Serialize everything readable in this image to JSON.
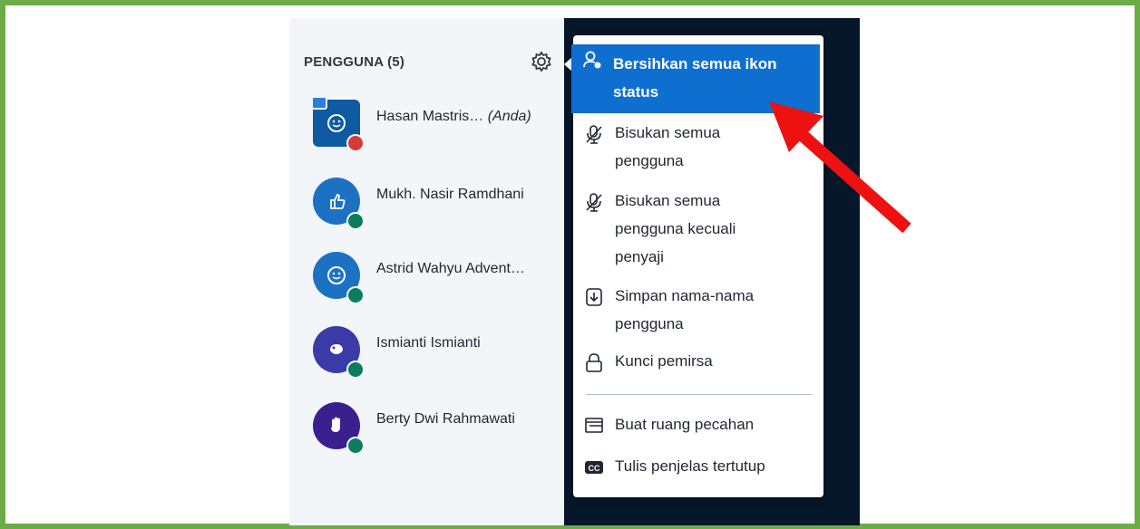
{
  "panel": {
    "title": "PENGGUNA (5)",
    "users": [
      {
        "name": "Hasan Mastris…",
        "suffix": "(Anda)",
        "emoji": "smile",
        "status": "presenter-muted"
      },
      {
        "name": "Mukh. Nasir Ramdhani",
        "suffix": "",
        "emoji": "thumbs-up",
        "status": "listen"
      },
      {
        "name": "Astrid Wahyu Advent…",
        "suffix": "",
        "emoji": "smile",
        "status": "listen"
      },
      {
        "name": "Ismianti Ismianti",
        "suffix": "",
        "emoji": "applause",
        "status": "listen"
      },
      {
        "name": "Berty Dwi Rahmawati",
        "suffix": "",
        "emoji": "raise-hand",
        "status": "listen"
      }
    ]
  },
  "menu": {
    "items": [
      {
        "line1": "Bersihkan semua ikon",
        "line2": "status",
        "line3": "",
        "icon": "user-clear-icon",
        "active": true
      },
      {
        "line1": "Bisukan semua",
        "line2": "pengguna",
        "line3": "",
        "icon": "mute-icon"
      },
      {
        "line1": "Bisukan semua",
        "line2": "pengguna kecuali",
        "line3": "penyaji",
        "icon": "mute-icon"
      },
      {
        "line1": "Simpan nama-nama",
        "line2": "pengguna",
        "line3": "",
        "icon": "download-icon"
      },
      {
        "line1": "Kunci pemirsa",
        "line2": "",
        "line3": "",
        "icon": "lock-icon"
      },
      {
        "line1": "Buat ruang pecahan",
        "line2": "",
        "line3": "",
        "icon": "breakout-icon"
      },
      {
        "line1": "Tulis penjelas tertutup",
        "line2": "",
        "line3": "",
        "icon": "cc-icon"
      }
    ]
  },
  "colors": {
    "accent": "#0f6fd1",
    "frame": "#6cac47",
    "arrow": "#ee1111"
  }
}
